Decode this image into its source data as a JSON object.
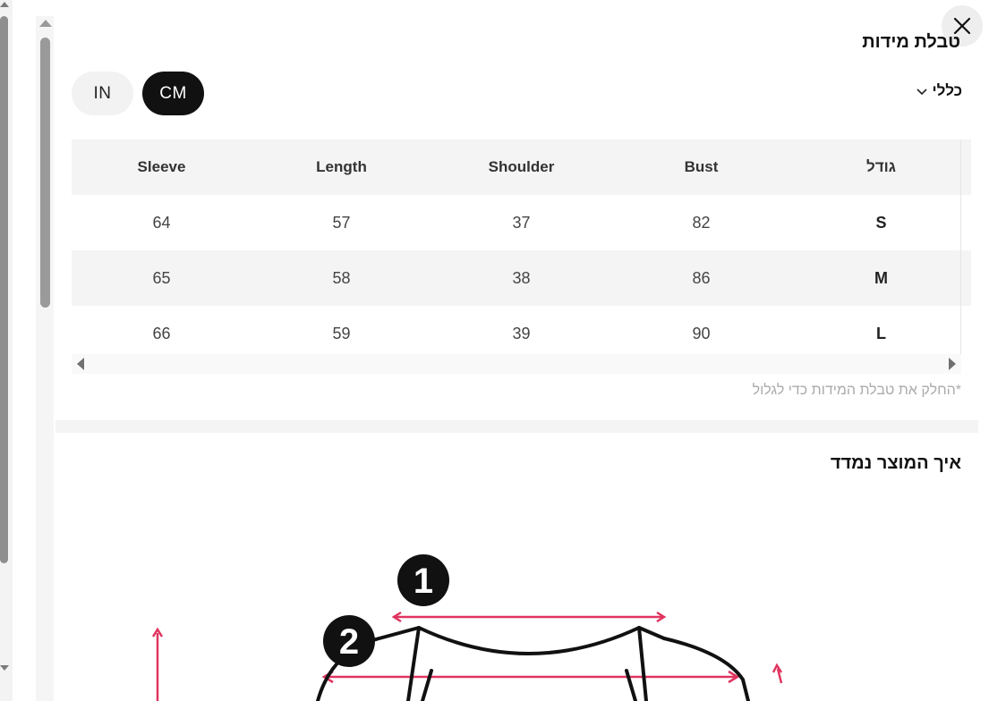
{
  "modal": {
    "title": "טבלת מידות",
    "close_icon": "close-icon"
  },
  "units": {
    "options": [
      "IN",
      "CM"
    ],
    "selected": "CM"
  },
  "dropdown": {
    "label": "כללי",
    "icon": "chevron-down-icon"
  },
  "table": {
    "headers": [
      "Sleeve",
      "Length",
      "Shoulder",
      "Bust",
      "גודל"
    ],
    "rows": [
      [
        "64",
        "57",
        "37",
        "82",
        "S"
      ],
      [
        "65",
        "58",
        "38",
        "86",
        "M"
      ],
      [
        "66",
        "59",
        "39",
        "90",
        "L"
      ]
    ]
  },
  "hint": "*החלק את טבלת המידות כדי לגלול",
  "measure_section": {
    "title": "איך המוצר נמדד",
    "markers": [
      "1",
      "2"
    ],
    "accent_color": "#e0345f"
  }
}
